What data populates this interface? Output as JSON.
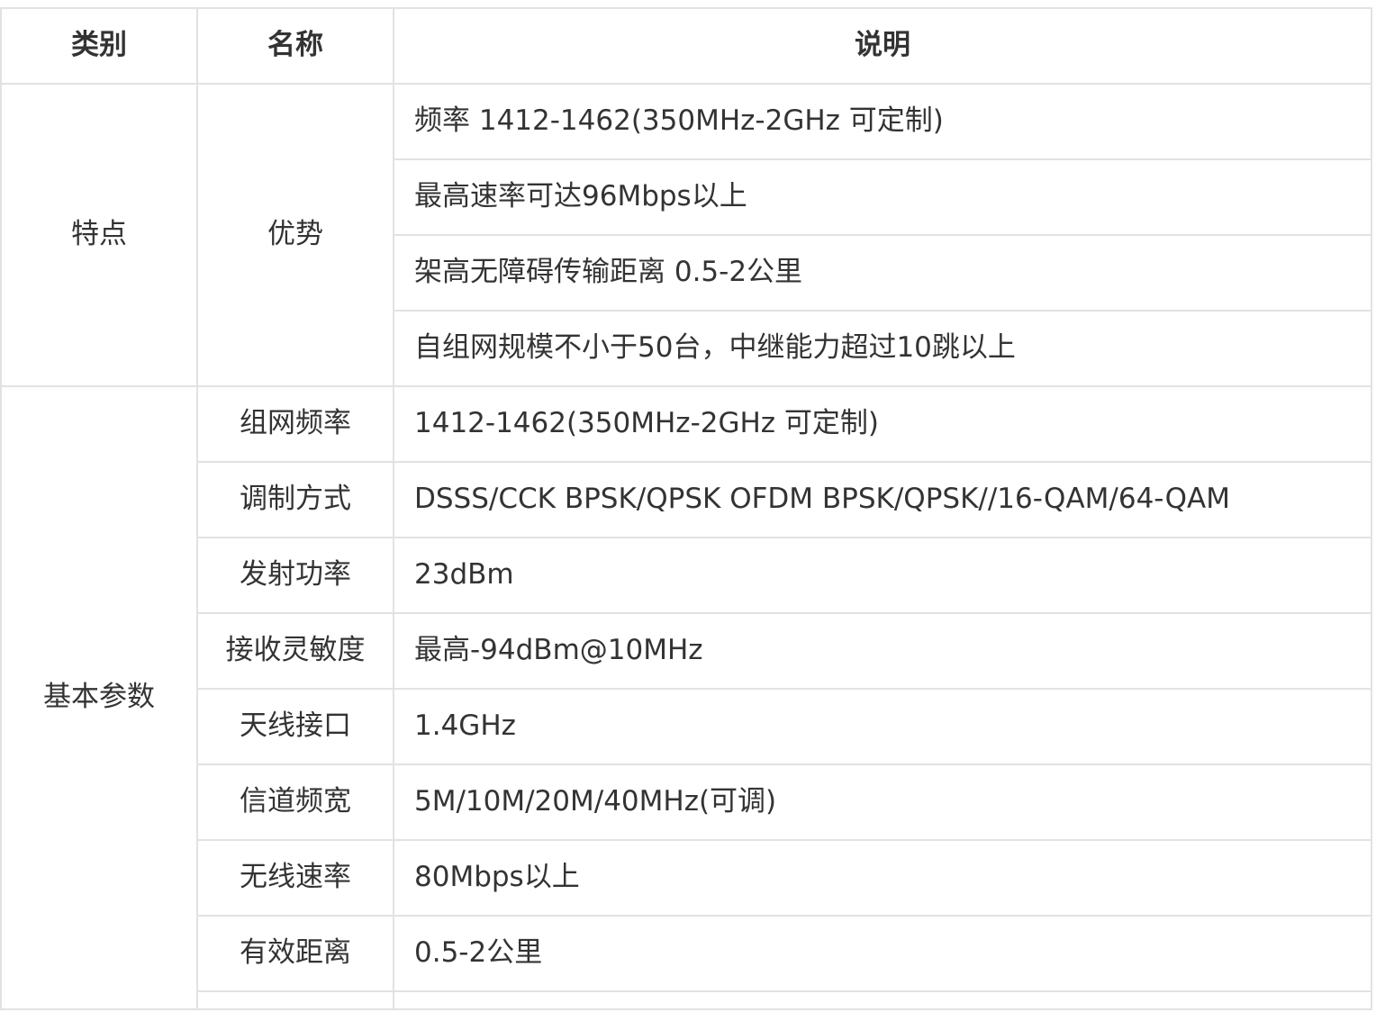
{
  "header": {
    "category": "类别",
    "name": "名称",
    "description": "说明"
  },
  "features": {
    "category": "特点",
    "name": "优势",
    "items": [
      "频率 1412-1462(350MHz-2GHz 可定制)",
      "最高速率可达96Mbps以上",
      "架高无障碍传输距离 0.5-2公里",
      "自组网规模不小于50台，中继能力超过10跳以上"
    ]
  },
  "basic_params": {
    "category": "基本参数",
    "rows": [
      {
        "name": "组网频率",
        "value": "1412-1462(350MHz-2GHz 可定制)"
      },
      {
        "name": "调制方式",
        "value": "DSSS/CCK BPSK/QPSK OFDM  BPSK/QPSK//16-QAM/64-QAM"
      },
      {
        "name": "发射功率",
        "value": "23dBm"
      },
      {
        "name": "接收灵敏度",
        "value": "最高-94dBm@10MHz"
      },
      {
        "name": "天线接口",
        "value": "1.4GHz"
      },
      {
        "name": "信道频宽",
        "value": "5M/10M/20M/40MHz(可调)"
      },
      {
        "name": "无线速率",
        "value": "80Mbps以上"
      },
      {
        "name": "有效距离",
        "value": "0.5-2公里"
      }
    ]
  },
  "colors": {
    "border": "#e2e2e2",
    "text": "#333333"
  }
}
